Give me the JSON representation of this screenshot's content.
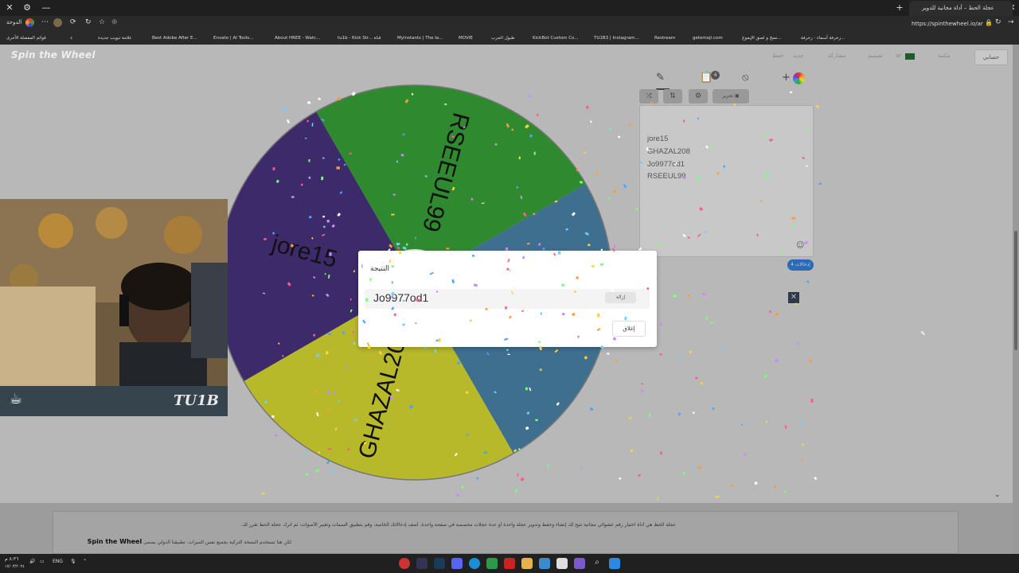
{
  "browser": {
    "tab_title": "عجلة الحظ – أداة مجانية للدوير",
    "url": "https://spinthewheel.io/ar",
    "bookmarks_left": "قوائم المفضلة الأخرى",
    "bookmarks": [
      "علامة تبويب جديدة",
      "Best Adobe After E...",
      "Envato | AI Tools...",
      "About HREE - Watc...",
      "tu1b - Kick Str... قناة",
      "Myinstants | The la...",
      "MOVIE",
      "طبول الحرب",
      "KickBot Custom Co...",
      "TU1B3 | Instagram...",
      "Restream",
      "getemoji.com",
      "نسخ و لصق الإيموج...",
      "زخرفة أسماء - زخرفة..."
    ],
    "home_label": "الدوحة"
  },
  "site": {
    "logo": "Spin the Wheel",
    "nav": [
      "حفظ",
      "جديد",
      "مشاركة",
      "تصميم",
      "ar",
      "مكتبة"
    ],
    "profile": "حسابي"
  },
  "wheel": {
    "segments": [
      {
        "label": "RSEEUL99",
        "color": "#2f8a2f"
      },
      {
        "label": "Jo9977od1",
        "color": "#3f6f8f"
      },
      {
        "label": "GHAZAL208",
        "color": "#b8b82b"
      },
      {
        "label": "jore15",
        "color": "#3d2a6a"
      }
    ]
  },
  "panel": {
    "tool_add": "+",
    "tool_edit": "تحرير",
    "entries": [
      "jore15",
      "GHAZAL208",
      "Jo9977od1",
      "RSEEUL99"
    ],
    "entries_count": "إدخالات 4",
    "close": "✕",
    "clipboard_badge": "4"
  },
  "dialog": {
    "title": "النتيجة",
    "result": "Jo9977od1",
    "remove": "إزالة",
    "close": "إغلاق"
  },
  "webcam": {
    "name": "TU1B",
    "logo": "☕"
  },
  "footer": {
    "line1": "عجلة الحظ هي أداة اختيار رقم عشوائي مجانية تتيح لك إنشاء وحفظ وتدوير عجلة واحدة أو عدة عجلات مخصصة في صفحة واحدة. أضف إدخالاتك الخاصة، وقم بتطبيق السمات وتغيير الأصوات، ثم اترك عجلة الحظ تقرر لك.",
    "line2_prefix": "لكن هنا تستخدم النسخة التركية بجميع نفس الميزات. تطبيقنا الدولي يسمى",
    "line2_brand": "Spin the Wheel"
  },
  "taskbar": {
    "time": "٨:٣٦ م",
    "date": "١٧/٠٣/٢٠٢٤",
    "lang": "ENG"
  },
  "colors": {
    "dialog_bg": "#ffffff",
    "badge_blue": "#2a6bb7"
  }
}
